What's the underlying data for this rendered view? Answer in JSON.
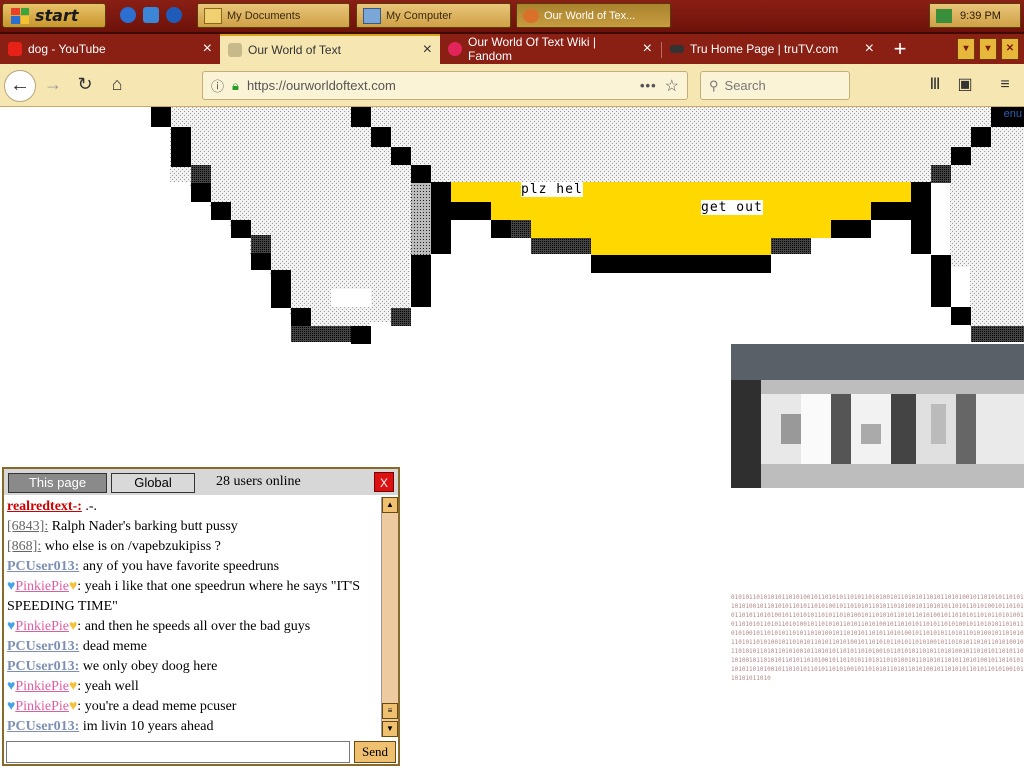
{
  "taskbar": {
    "start_label": "start",
    "windows": [
      {
        "label": "My Documents",
        "active": false
      },
      {
        "label": "My Computer",
        "active": false
      },
      {
        "label": "Our World of Tex...",
        "active": true
      }
    ],
    "clock": "9:39 PM"
  },
  "browser": {
    "tabs": [
      {
        "label": "dog - YouTube",
        "icon": "youtube-icon",
        "active": false
      },
      {
        "label": "Our World of Text",
        "icon": "owot-icon",
        "active": true
      },
      {
        "label": "Our World Of Text Wiki | Fandom",
        "icon": "fandom-icon",
        "active": false
      },
      {
        "label": "Tru Home Page | truTV.com",
        "icon": "trutv-icon",
        "active": false
      }
    ],
    "url": "https://ourworldoftext.com",
    "search_placeholder": "Search"
  },
  "canvas": {
    "texts": [
      "plz hel",
      "get out"
    ],
    "corner_text": "enu"
  },
  "binary_text": "01010110101010110101001011010101101011010100101101010110101101010010110101011010110101001011010101101011010100101101010110101101010010110101011010110101001011010101101011010100101101010110101101010010110101011010110101001011010101101011010100101101010110101101010010110101011010110101001011010101101011010100101101010110101101010010110101011010110101001011010101101011010100101101010110101101010010110101011010110101001011010101101011010100101101010110101101010010110101011010110101001011010101101011010100101101010110101101010010110101011010110101001011010101101011010100101101010110101101010010110101011010110101001011010101101011010100101101010110101101010010110101011010110101001011010101101011010100101101010110101101010010110101011010",
  "chat": {
    "tab_page": "This page",
    "tab_global": "Global",
    "online": "28 users online",
    "close": "X",
    "send": "Send",
    "messages": [
      {
        "name": "realredtext-:",
        "style": "red",
        "hearts": false,
        "text": " .-."
      },
      {
        "name": "[6843]:",
        "style": "gray",
        "hearts": false,
        "text": " Ralph Nader's barking butt pussy"
      },
      {
        "name": "[868]:",
        "style": "gray",
        "hearts": false,
        "text": " who else is on /vapebzukipiss ?"
      },
      {
        "name": "PCUser013:",
        "style": "blue",
        "hearts": false,
        "text": " any of you have favorite speedruns"
      },
      {
        "name": "PinkiePie",
        "style": "pink",
        "hearts": true,
        "text": " yeah i like that one speedrun where he says \"IT'S SPEEDING TIME\""
      },
      {
        "name": "PinkiePie",
        "style": "pink",
        "hearts": true,
        "text": " and then he speeds all over the bad guys"
      },
      {
        "name": "PCUser013:",
        "style": "blue",
        "hearts": false,
        "text": " dead meme"
      },
      {
        "name": "PCUser013:",
        "style": "blue",
        "hearts": false,
        "text": " we only obey doog here"
      },
      {
        "name": "PinkiePie",
        "style": "pink",
        "hearts": true,
        "text": " yeah well"
      },
      {
        "name": "PinkiePie",
        "style": "pink",
        "hearts": true,
        "text": " you're a dead meme pcuser"
      },
      {
        "name": "PCUser013:",
        "style": "blue",
        "hearts": false,
        "text": " im livin 10 years ahead"
      }
    ]
  }
}
